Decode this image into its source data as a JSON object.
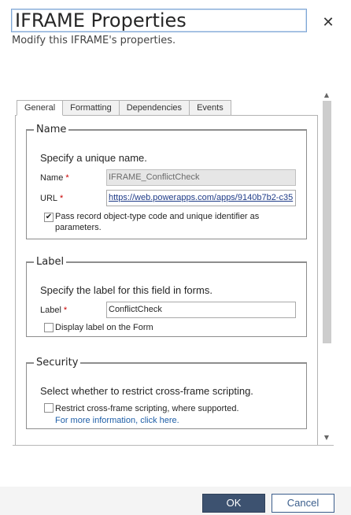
{
  "dialog": {
    "title": "IFRAME Properties",
    "subtitle": "Modify this IFRAME's properties.",
    "close_glyph": "✕"
  },
  "tabs": [
    {
      "label": "General",
      "active": true
    },
    {
      "label": "Formatting",
      "active": false
    },
    {
      "label": "Dependencies",
      "active": false
    },
    {
      "label": "Events",
      "active": false
    }
  ],
  "name_section": {
    "legend": "Name",
    "description": "Specify a unique name.",
    "name_label": "Name",
    "name_value": "IFRAME_ConflictCheck",
    "url_label": "URL",
    "url_value": "https://web.powerapps.com/apps/9140b7b2-c35",
    "required_marker": "*",
    "pass_params_checked": true,
    "pass_params_label": "Pass record object-type code and unique identifier as parameters."
  },
  "label_section": {
    "legend": "Label",
    "description": "Specify the label for this field in forms.",
    "label_label": "Label",
    "label_value": "ConflictCheck",
    "required_marker": "*",
    "display_label_checked": false,
    "display_label_text": "Display label on the Form"
  },
  "security_section": {
    "legend": "Security",
    "description": "Select whether to restrict cross-frame scripting.",
    "restrict_checked": false,
    "restrict_label": "Restrict cross-frame scripting, where supported.",
    "more_info_link": "For more information, click here."
  },
  "footer": {
    "ok_label": "OK",
    "cancel_label": "Cancel"
  },
  "colors": {
    "ok_button": "#3d5270",
    "cancel_border": "#3b5e8c",
    "required": "#c80000",
    "link": "#1f5fa8"
  },
  "icons": {
    "close": "close-icon",
    "checkbox_checked": "checkmark-icon",
    "scroll_up": "triangle-up-icon",
    "scroll_down": "triangle-down-icon"
  }
}
